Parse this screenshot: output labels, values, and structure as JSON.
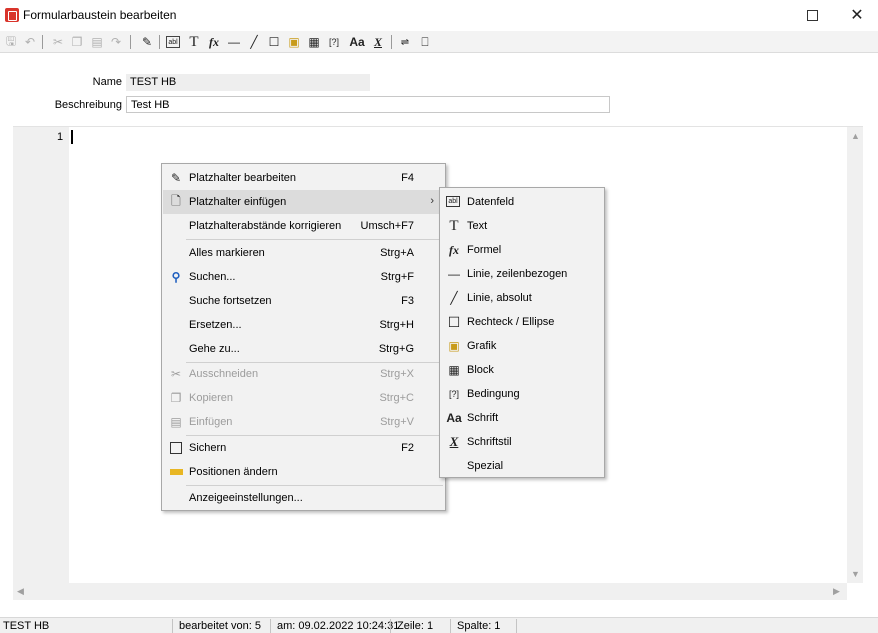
{
  "window": {
    "title": "Formularbaustein bearbeiten",
    "maximize_label": "",
    "close_label": "✕"
  },
  "form": {
    "name_label": "Name",
    "name_value": "TEST HB",
    "description_label": "Beschreibung",
    "description_value": "Test HB"
  },
  "editor": {
    "line_number": "1"
  },
  "context_menu": {
    "items": [
      {
        "label": "Platzhalter bearbeiten",
        "shortcut": "F4",
        "icon": "pencil-icon",
        "enabled": true
      },
      {
        "label": "Platzhalter einfügen",
        "shortcut": "",
        "icon": "insert-placeholder-icon",
        "enabled": true,
        "submenu": true
      },
      {
        "label": "Platzhalterabstände korrigieren",
        "shortcut": "Umsch+F7",
        "icon": "",
        "enabled": true
      },
      {
        "label": "Alles markieren",
        "shortcut": "Strg+A",
        "icon": "",
        "enabled": true
      },
      {
        "label": "Suchen...",
        "shortcut": "Strg+F",
        "icon": "search-icon",
        "enabled": true
      },
      {
        "label": "Suche fortsetzen",
        "shortcut": "F3",
        "icon": "",
        "enabled": true
      },
      {
        "label": "Ersetzen...",
        "shortcut": "Strg+H",
        "icon": "",
        "enabled": true
      },
      {
        "label": "Gehe zu...",
        "shortcut": "Strg+G",
        "icon": "",
        "enabled": true
      },
      {
        "label": "Ausschneiden",
        "shortcut": "Strg+X",
        "icon": "cut-icon",
        "enabled": false
      },
      {
        "label": "Kopieren",
        "shortcut": "Strg+C",
        "icon": "copy-icon",
        "enabled": false
      },
      {
        "label": "Einfügen",
        "shortcut": "Strg+V",
        "icon": "paste-icon",
        "enabled": false
      },
      {
        "label": "Sichern",
        "shortcut": "F2",
        "icon": "save-icon",
        "enabled": true
      },
      {
        "label": "Positionen ändern",
        "shortcut": "",
        "icon": "ruler-icon",
        "enabled": true
      },
      {
        "label": "Anzeigeeinstellungen...",
        "shortcut": "",
        "icon": "",
        "enabled": true
      }
    ]
  },
  "submenu": {
    "items": [
      {
        "label": "Datenfeld",
        "icon": "datafield-icon"
      },
      {
        "label": "Text",
        "icon": "text-icon"
      },
      {
        "label": "Formel",
        "icon": "formula-icon"
      },
      {
        "label": "Linie, zeilenbezogen",
        "icon": "horizontal-line-icon"
      },
      {
        "label": "Linie, absolut",
        "icon": "diagonal-line-icon"
      },
      {
        "label": "Rechteck / Ellipse",
        "icon": "rectangle-icon"
      },
      {
        "label": "Grafik",
        "icon": "image-icon"
      },
      {
        "label": "Block",
        "icon": "block-icon"
      },
      {
        "label": "Bedingung",
        "icon": "condition-icon"
      },
      {
        "label": "Schrift",
        "icon": "font-icon"
      },
      {
        "label": "Schriftstil",
        "icon": "font-style-icon"
      },
      {
        "label": "Spezial",
        "icon": ""
      }
    ]
  },
  "statusbar": {
    "name": "TEST HB",
    "edited_by": "bearbeitet von:  5",
    "date": "am: 09.02.2022 10:24:31",
    "line": "Zeile: 1",
    "column": "Spalte: 1"
  },
  "colors": {
    "app_icon": "#d9342b",
    "highlight": "#dcdcdc"
  }
}
